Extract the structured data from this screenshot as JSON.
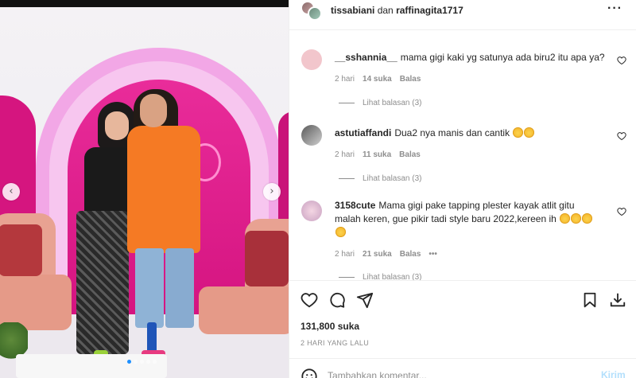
{
  "post": {
    "owner_1": "tissabiani",
    "joiner": "dan",
    "owner_2": "raffinagita1717",
    "more_icon": "more-horizontal-icon"
  },
  "photo": {
    "carousel_dot_count": 5,
    "carousel_active_index": 0,
    "prev_icon": "chevron-left-icon",
    "next_icon": "chevron-right-icon"
  },
  "comments": [
    {
      "user": "__sshannia__",
      "text": "mama gigi kaki yg satunya ada biru2 itu apa ya?",
      "time": "2 hari",
      "likes": "14 suka",
      "reply": "Balas",
      "view_replies": "Lihat balasan (3)",
      "avatar_color": "#f2c6cc"
    },
    {
      "user": "astutiaffandi",
      "text": "Dua2 nya manis dan cantik",
      "time": "2 hari",
      "likes": "11 suka",
      "reply": "Balas",
      "view_replies": "Lihat balasan (3)",
      "avatar_color": "#9a9a9a"
    },
    {
      "user": "3158cute",
      "text": "Mama gigi pake tapping plester kayak atlit gitu malah keren, gue pikir tadi style baru 2022,kereen ih",
      "time": "2 hari",
      "likes": "21 suka",
      "reply": "Balas",
      "more": "•••",
      "view_replies": "Lihat balasan (3)",
      "avatar_color": "#e4bcd2"
    }
  ],
  "actions": {
    "like_icon": "heart-icon",
    "comment_icon": "comment-icon",
    "share_icon": "send-icon",
    "save_icon": "bookmark-icon",
    "download_icon": "download-icon"
  },
  "likes_count": "131,800 suka",
  "posted_ago": "2 HARI YANG LALU",
  "composer": {
    "placeholder": "Tambahkan komentar...",
    "post_label": "Kirim",
    "emoji_icon": "smiley-icon"
  },
  "colors": {
    "text": "#262626",
    "muted": "#8e8e8e",
    "link_disabled": "#b2dffc",
    "carousel_active": "#1e90ff"
  }
}
